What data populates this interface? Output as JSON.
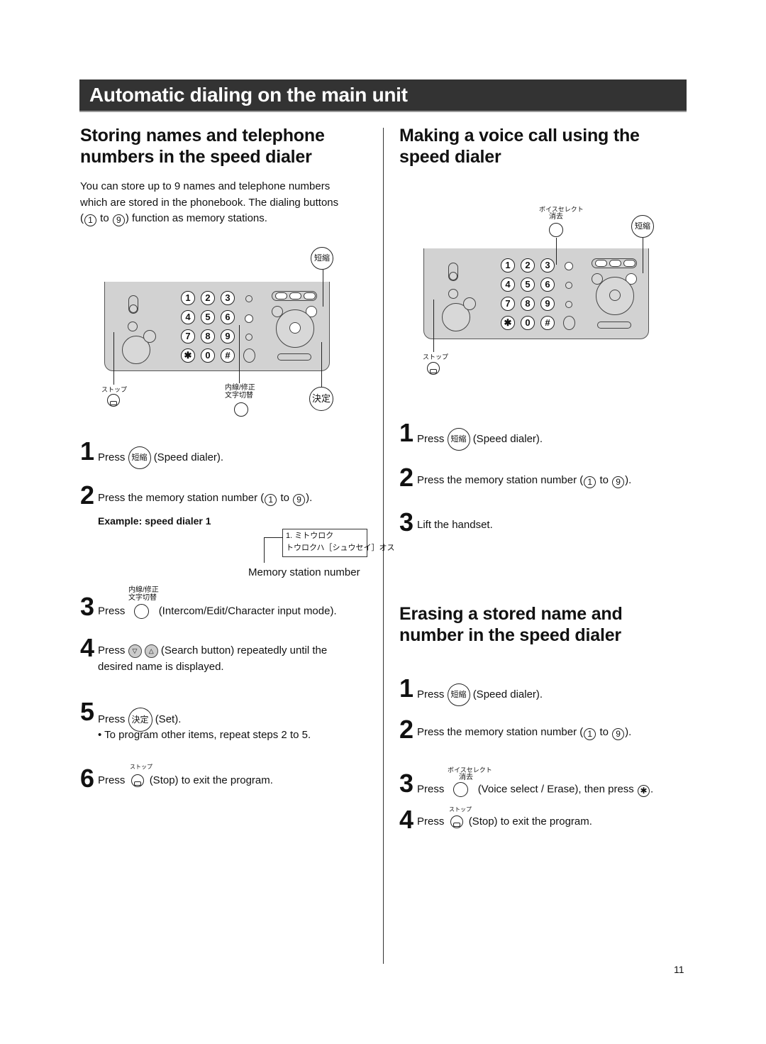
{
  "page": {
    "title": "Automatic dialing on the main unit",
    "page_number": "11"
  },
  "left": {
    "heading_line1": "Storing names and telephone",
    "heading_line2": "numbers in the speed dialer",
    "intro_line1": "You can store up to 9 names and telephone numbers",
    "intro_line2": "which are stored in the phonebook. The dialing buttons",
    "intro_line3_pre": "(",
    "intro_key_start": "1",
    "intro_to": "to",
    "intro_key_end": "9",
    "intro_line3_post": ") function as memory stations.",
    "diagram": {
      "callout_speed": "短縮",
      "callout_set": "決定",
      "label_stop": "ストップ",
      "label_intercom_1": "内線/修正",
      "label_intercom_2": "文字切替"
    },
    "steps": [
      {
        "num": "1",
        "pre": "Press",
        "button": "短縮",
        "post": "(Speed dialer)."
      },
      {
        "num": "2",
        "pre": "Press the memory station number (",
        "key_start": "1",
        "to": "to",
        "key_end": "9",
        "post": ")."
      },
      {
        "num": "3",
        "pre": "Press",
        "button_label_1": "内線/修正",
        "button_label_2": "文字切替",
        "post": "(Intercom/Edit/Character input mode)."
      },
      {
        "num": "4",
        "pre": "Press",
        "btn_down": "▽",
        "btn_up": "△",
        "post": "(Search button) repeatedly until the",
        "post2": "desired name is displayed."
      },
      {
        "num": "5",
        "pre": "Press",
        "button": "決定",
        "post": "(Set).",
        "bullet": "To program other items, repeat steps 2 to 5."
      },
      {
        "num": "6",
        "pre": "Press",
        "button_label": "ストップ",
        "post": "(Stop) to exit the program."
      }
    ],
    "example_label": "Example: speed dialer 1",
    "lcd_line1": "1. ミトウロク",
    "lcd_line2": "トウロクハ［シュウセイ］オス",
    "memory_label": "Memory station number"
  },
  "right_top": {
    "heading_line1": "Making a voice call using the",
    "heading_line2": "speed dialer",
    "diagram": {
      "label_voice_1": "ボイスセレクト",
      "label_voice_2": "消去",
      "callout_speed": "短縮",
      "label_stop": "ストップ"
    },
    "steps": [
      {
        "num": "1",
        "pre": "Press",
        "button": "短縮",
        "post": "(Speed dialer)."
      },
      {
        "num": "2",
        "pre": "Press the memory station number (",
        "key_start": "1",
        "to": "to",
        "key_end": "9",
        "post": ")."
      },
      {
        "num": "3",
        "text": "Lift the handset."
      }
    ]
  },
  "right_bottom": {
    "heading_line1": "Erasing a stored name and",
    "heading_line2": "number in the speed dialer",
    "steps": [
      {
        "num": "1",
        "pre": "Press",
        "button": "短縮",
        "post": "(Speed dialer)."
      },
      {
        "num": "2",
        "pre": "Press the memory station number (",
        "key_start": "1",
        "to": "to",
        "key_end": "9",
        "post": ")."
      },
      {
        "num": "3",
        "pre": "Press",
        "button_label_1": "ボイスセレクト",
        "button_label_2": "消去",
        "post": "(Voice select / Erase), then press",
        "star": "✱",
        "end": "."
      },
      {
        "num": "4",
        "pre": "Press",
        "button_label": "ストップ",
        "post": "(Stop) to exit the program."
      }
    ]
  },
  "keypad": [
    "1",
    "2",
    "3",
    "4",
    "5",
    "6",
    "7",
    "8",
    "9",
    "✱",
    "0",
    "#"
  ]
}
